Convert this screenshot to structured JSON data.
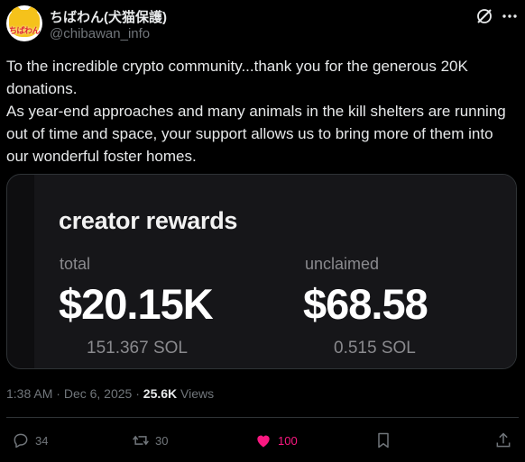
{
  "author": {
    "display_name": "ちばわん(犬猫保護)",
    "handle": "@chibawan_info",
    "avatar_text": "ちばわん"
  },
  "header_icons": [
    "grok-icon",
    "more-options-icon"
  ],
  "post": {
    "paragraph1": "To the incredible crypto community...thank you for the generous 20K donations.",
    "paragraph2": "As year-end approaches and many animals in the kill shelters are running out of time and space, your support allows us to bring more of them into our wonderful foster homes."
  },
  "media": {
    "title": "creator rewards",
    "total": {
      "label": "total",
      "value": "$20.15K",
      "sub": "151.367 SOL"
    },
    "unclaimed": {
      "label": "unclaimed",
      "value": "$68.58",
      "sub": "0.515 SOL"
    }
  },
  "meta": {
    "time": "1:38 AM",
    "separator": "·",
    "date": "Dec 6, 2025",
    "views_count": "25.6K",
    "views_label": "Views"
  },
  "actions": {
    "replies": "34",
    "reposts": "30",
    "likes": "100"
  },
  "colors": {
    "background": "#000000",
    "text": "#e7e9ea",
    "muted": "#71767b",
    "like": "#f91880",
    "border": "#2f3336"
  }
}
